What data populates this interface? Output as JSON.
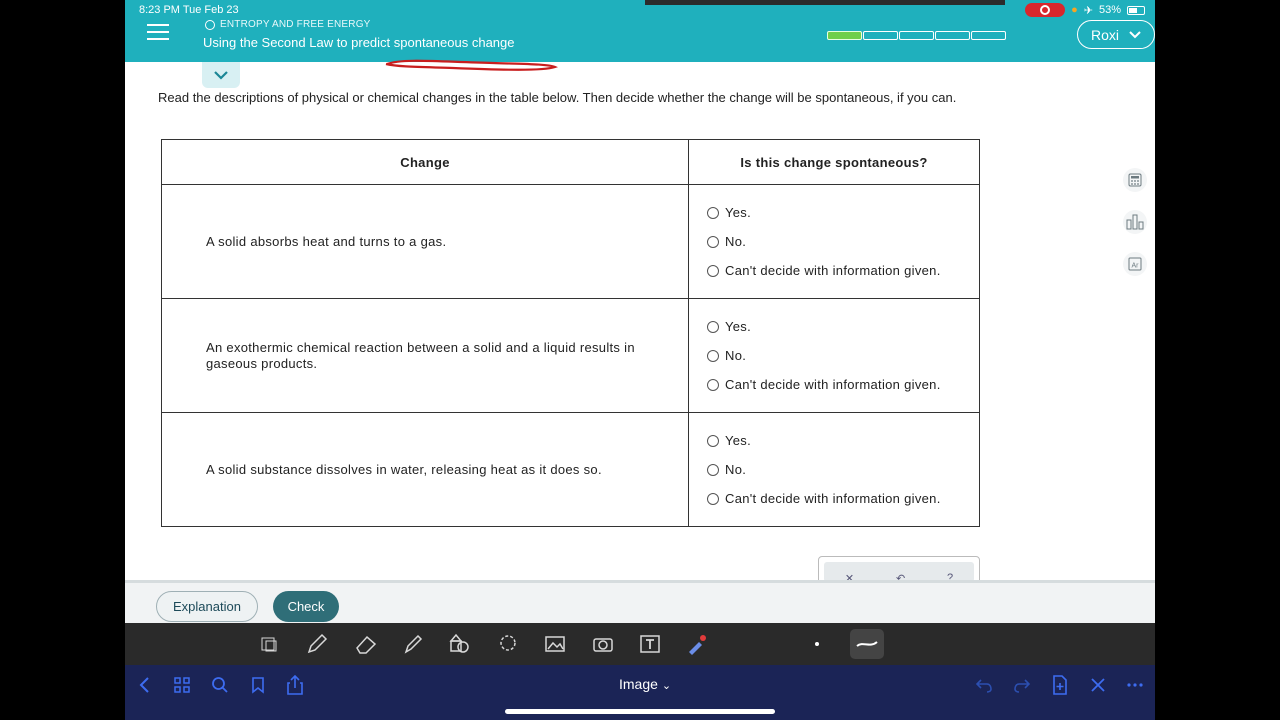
{
  "status_bar": {
    "time": "8:23 PM   Tue Feb 23",
    "battery": "53%",
    "airplane_icon": "airplane-icon"
  },
  "header": {
    "topic": "ENTROPY AND FREE ENERGY",
    "title": "Using the Second Law to predict spontaneous change",
    "progress_filled": 1,
    "progress_total": 5,
    "user_name": "Roxi",
    "accent_color": "#1fb0bd"
  },
  "main": {
    "instructions": "Read the descriptions of physical or chemical changes in the table below. Then decide whether the change will be spontaneous, if you can.",
    "table": {
      "headers": [
        "Change",
        "Is this change spontaneous?"
      ],
      "rows": [
        {
          "change": "A solid absorbs heat and turns to a gas.",
          "options": [
            "Yes.",
            "No.",
            "Can't decide with information given."
          ]
        },
        {
          "change": "An exothermic chemical reaction between a solid and a liquid results in gaseous products.",
          "options": [
            "Yes.",
            "No.",
            "Can't decide with information given."
          ]
        },
        {
          "change": "A solid substance dissolves in water, releasing heat as it does so.",
          "options": [
            "Yes.",
            "No.",
            "Can't decide with information given."
          ]
        }
      ]
    }
  },
  "footer": {
    "explanation_label": "Explanation",
    "check_label": "Check"
  },
  "app_bar": {
    "mode_label": "Image",
    "chevron": "⌄"
  }
}
